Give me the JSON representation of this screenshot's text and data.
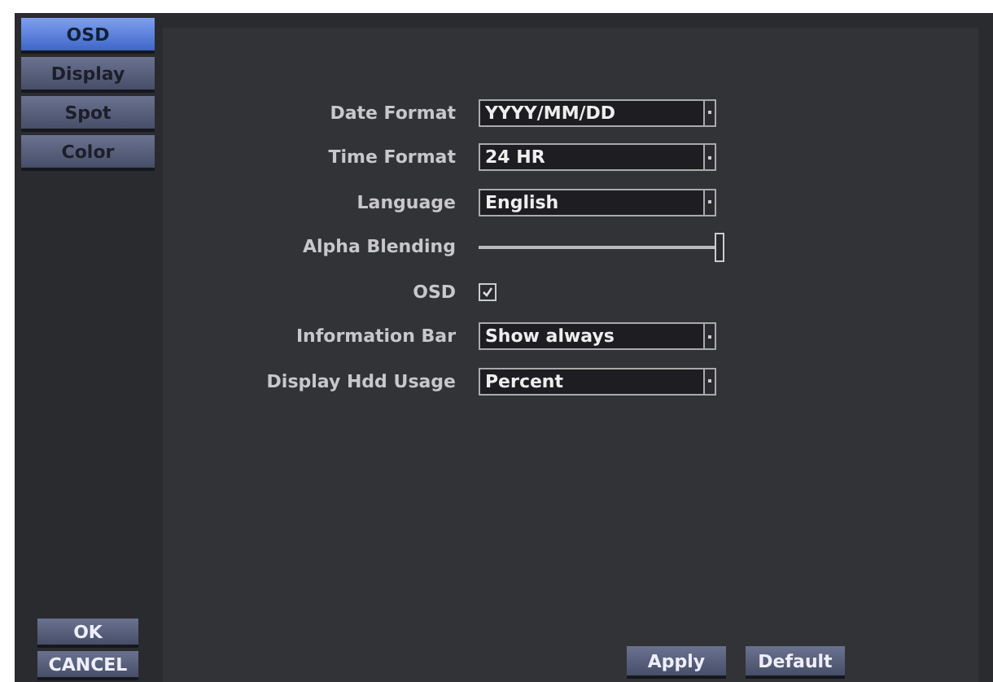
{
  "sidebar": {
    "items": [
      {
        "label": "OSD",
        "selected": true
      },
      {
        "label": "Display",
        "selected": false
      },
      {
        "label": "Spot",
        "selected": false
      },
      {
        "label": "Color",
        "selected": false
      }
    ],
    "buttons": [
      "OK",
      "CANCEL"
    ]
  },
  "settings": [
    {
      "kind": "select",
      "label": "Date Format",
      "value": "YYYY/MM/DD"
    },
    {
      "kind": "select",
      "label": "Time Format",
      "value": "24 HR"
    },
    {
      "kind": "select",
      "label": "Language",
      "value": "English"
    },
    {
      "kind": "slider",
      "label": "Alpha Blending",
      "level": 1.0
    },
    {
      "kind": "checkbox",
      "label": "OSD",
      "checked": true
    },
    {
      "kind": "select",
      "label": "Information Bar",
      "value": "Show always"
    },
    {
      "kind": "select",
      "label": "Display Hdd Usage",
      "value": "Percent"
    }
  ],
  "buttons": [
    "Apply",
    "Default"
  ]
}
